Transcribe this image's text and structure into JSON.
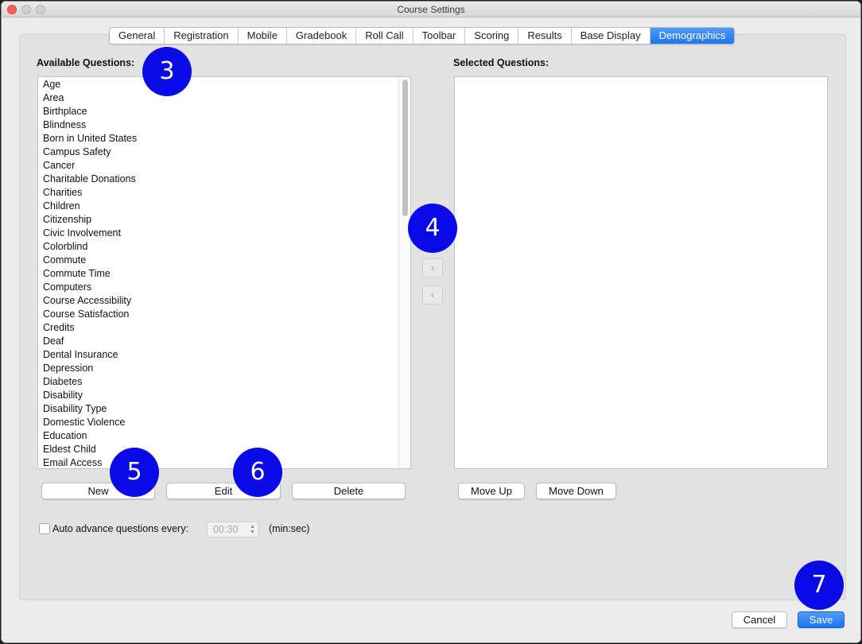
{
  "window": {
    "title": "Course Settings"
  },
  "tabs": [
    {
      "label": "General",
      "active": false
    },
    {
      "label": "Registration",
      "active": false
    },
    {
      "label": "Mobile",
      "active": false
    },
    {
      "label": "Gradebook",
      "active": false
    },
    {
      "label": "Roll Call",
      "active": false
    },
    {
      "label": "Toolbar",
      "active": false
    },
    {
      "label": "Scoring",
      "active": false
    },
    {
      "label": "Results",
      "active": false
    },
    {
      "label": "Base Display",
      "active": false
    },
    {
      "label": "Demographics",
      "active": true
    }
  ],
  "available": {
    "heading": "Available Questions:",
    "items": [
      "Age",
      "Area",
      "Birthplace",
      "Blindness",
      "Born in United States",
      "Campus Safety",
      "Cancer",
      "Charitable Donations",
      "Charities",
      "Children",
      "Citizenship",
      "Civic Involvement",
      "Colorblind",
      "Commute",
      "Commute Time",
      "Computers",
      "Course Accessibility",
      "Course Satisfaction",
      "Credits",
      "Deaf",
      "Dental Insurance",
      "Depression",
      "Diabetes",
      "Disability",
      "Disability Type",
      "Domestic Violence",
      "Education",
      "Eldest Child",
      "Email Access"
    ],
    "buttons": {
      "new": "New",
      "edit": "Edit",
      "delete": "Delete"
    }
  },
  "transfer": {
    "add": "›",
    "remove": "‹"
  },
  "selected": {
    "heading": "Selected Questions:",
    "items": [],
    "buttons": {
      "move_up": "Move Up",
      "move_down": "Move Down"
    }
  },
  "auto_advance": {
    "checked": false,
    "label": "Auto advance questions every:",
    "value": "00:30",
    "unit": "(min:sec)"
  },
  "footer": {
    "cancel": "Cancel",
    "save": "Save"
  },
  "callouts": [
    "3",
    "4",
    "5",
    "6",
    "7"
  ],
  "colors": {
    "accent": "#1f74f0",
    "callout": "#0a0ae6"
  }
}
